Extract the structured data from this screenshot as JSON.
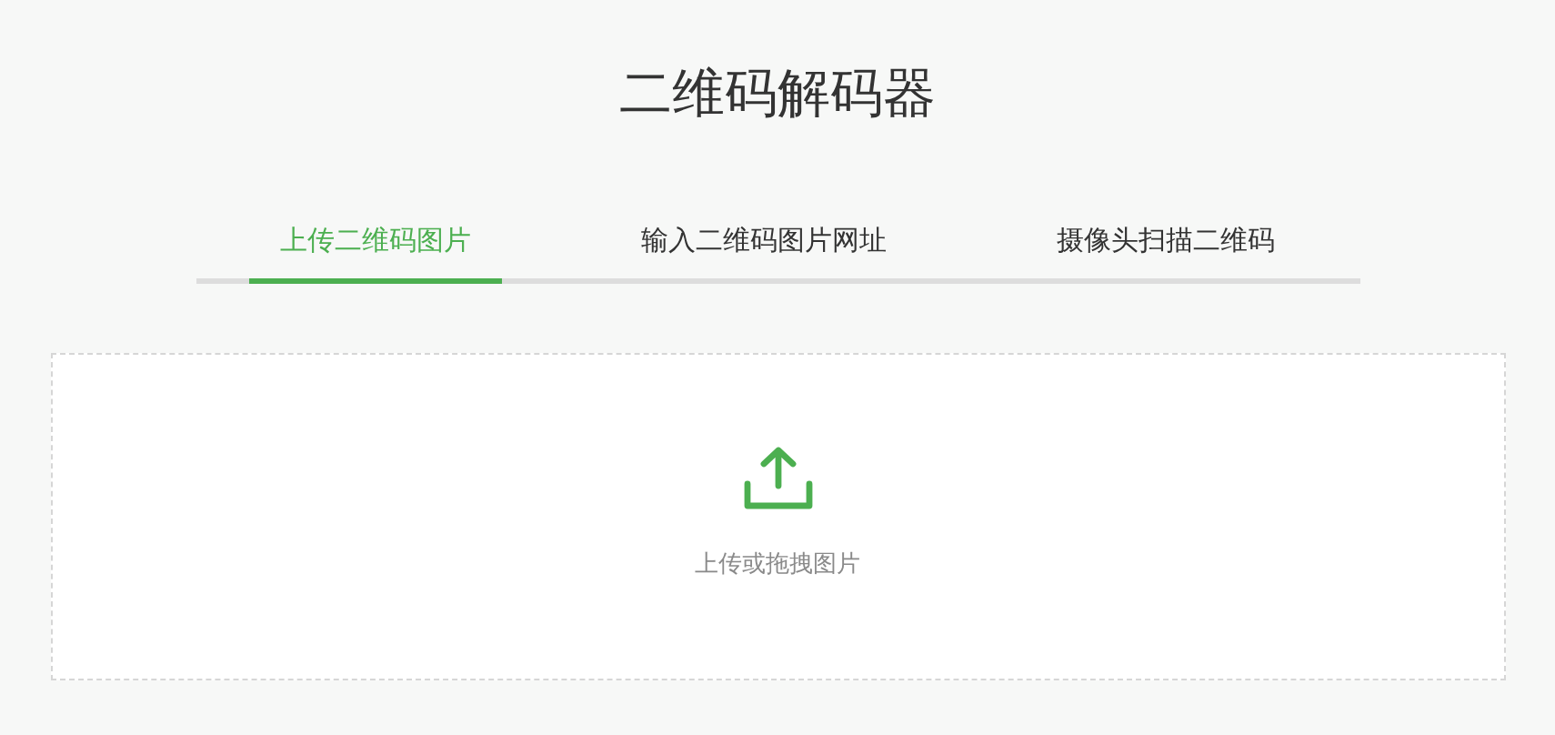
{
  "title": "二维码解码器",
  "tabs": [
    {
      "label": "上传二维码图片",
      "selected": true
    },
    {
      "label": "输入二维码图片网址",
      "selected": false
    },
    {
      "label": "摄像头扫描二维码",
      "selected": false
    }
  ],
  "upload": {
    "label": "上传或拖拽图片"
  }
}
